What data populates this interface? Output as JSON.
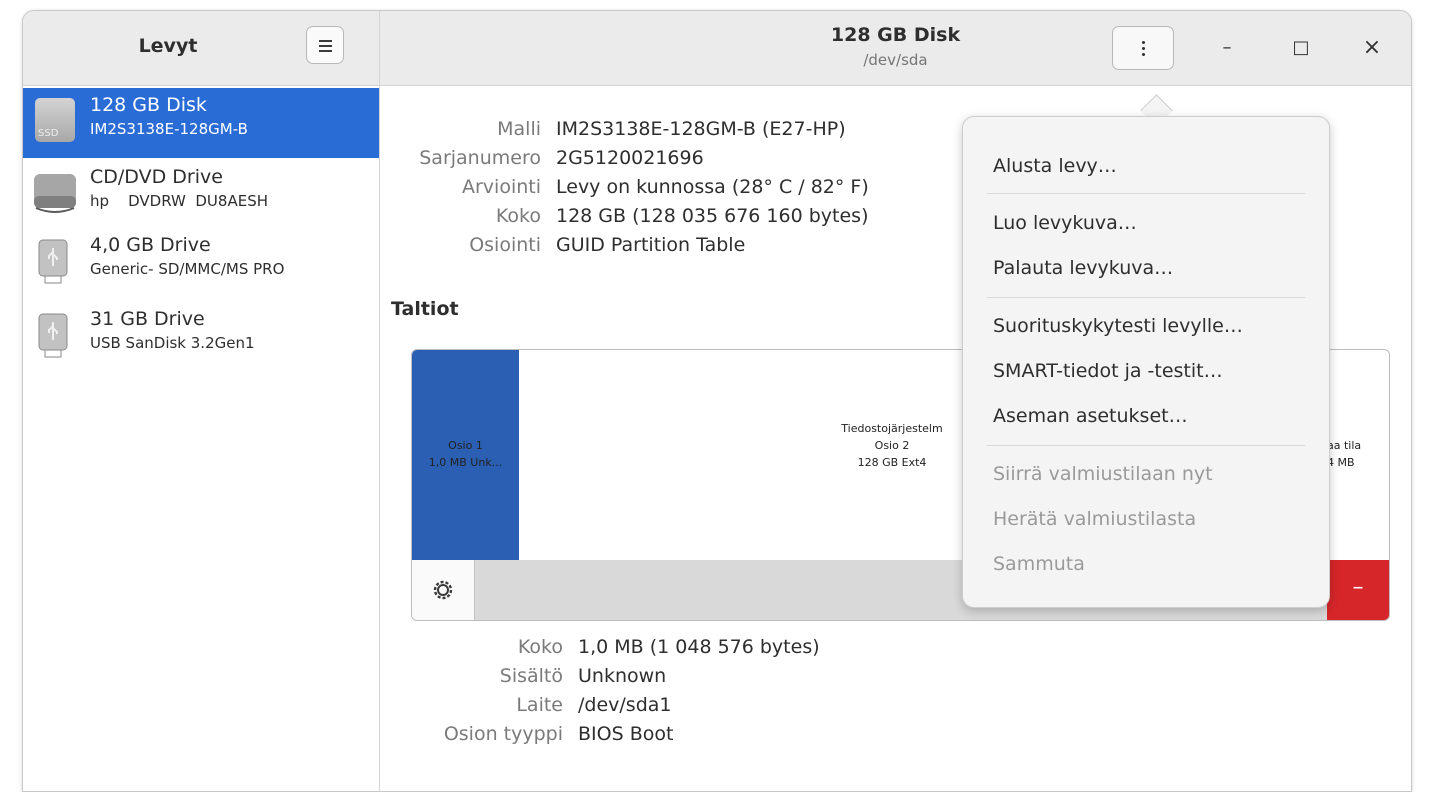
{
  "sidebar": {
    "title": "Levyt",
    "drives": [
      {
        "name": "128 GB Disk",
        "sub": "IM2S3138E-128GM-B",
        "icon": "ssd-icon",
        "icon_label": "SSD",
        "selected": true
      },
      {
        "name": "CD/DVD Drive",
        "sub": "hp    DVDRW  DU8AESH",
        "icon": "optical-drive-icon",
        "selected": false
      },
      {
        "name": "4,0 GB Drive",
        "sub": "Generic- SD/MMC/MS PRO",
        "icon": "usb-drive-icon",
        "selected": false
      },
      {
        "name": "31 GB Drive",
        "sub": "USB SanDisk 3.2Gen1",
        "icon": "usb-drive-icon",
        "selected": false
      }
    ]
  },
  "header": {
    "title": "128 GB Disk",
    "subtitle": "/dev/sda",
    "minimize": "–",
    "maximize": "□",
    "close": "×"
  },
  "disk_info": [
    {
      "label": "Malli",
      "value": "IM2S3138E-128GM-B (E27-HP)"
    },
    {
      "label": "Sarjanumero",
      "value": "2G5120021696"
    },
    {
      "label": "Arviointi",
      "value": "Levy on kunnossa (28° C / 82° F)"
    },
    {
      "label": "Koko",
      "value": "128 GB (128 035 676 160 bytes)"
    },
    {
      "label": "Osiointi",
      "value": "GUID Partition Table"
    }
  ],
  "volumes": {
    "heading": "Taltiot",
    "partition1": {
      "line1": "Osio 1",
      "line2": "1,0 MB Unk..."
    },
    "partition2": {
      "line1": "Tiedostojärjestelm",
      "line2": "Osio 2",
      "line3": "128 GB Ext4"
    },
    "free_space": {
      "line1": "aa tila",
      "line2": "4 MB"
    },
    "remove_label": "–"
  },
  "partition_info": [
    {
      "label": "Koko",
      "value": "1,0 MB (1 048 576 bytes)"
    },
    {
      "label": "Sisältö",
      "value": "Unknown"
    },
    {
      "label": "Laite",
      "value": "/dev/sda1"
    },
    {
      "label": "Osion tyyppi",
      "value": "BIOS Boot"
    }
  ],
  "menu": {
    "format": "Alusta levy…",
    "create_image": "Luo levykuva…",
    "restore_image": "Palauta levykuva…",
    "benchmark": "Suorituskykytesti levylle…",
    "smart": "SMART-tiedot ja -testit…",
    "drive_settings": "Aseman asetukset…",
    "standby_now": "Siirrä valmiustilaan nyt",
    "wake_up": "Herätä valmiustilasta",
    "power_off": "Sammuta"
  },
  "colors": {
    "selection": "#2a6cd6",
    "partition_selected": "#2a5fb3",
    "danger": "#d6262a"
  }
}
